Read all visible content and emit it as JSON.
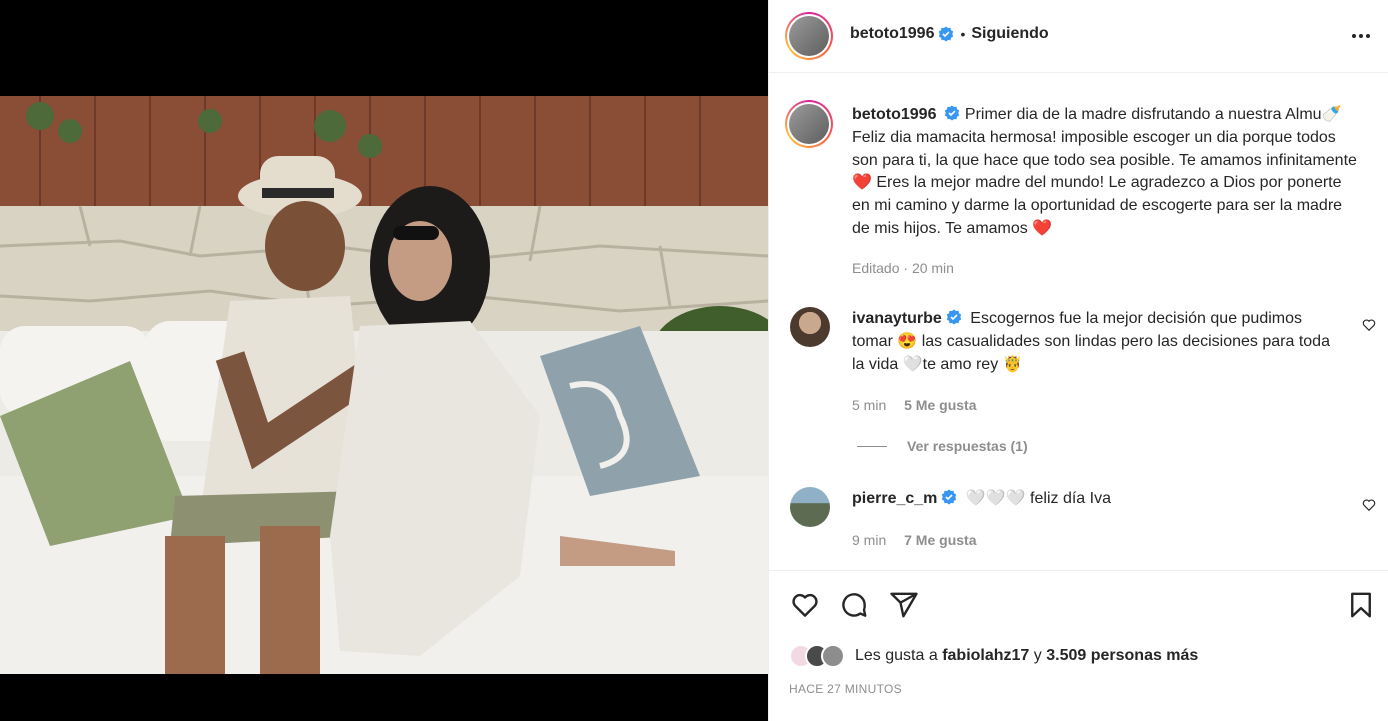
{
  "header": {
    "username": "betoto1996",
    "separator": "•",
    "follow_status": "Siguiendo"
  },
  "caption": {
    "username": "betoto1996",
    "text": "Primer dia de la madre disfrutando a nuestra Almu🍼 Feliz dia mamacita hermosa! imposible escoger un dia porque todos son para ti, la que hace que todo sea posible. Te amamos infinitamente❤️ Eres la mejor madre del mundo! Le agradezco a Dios por ponerte en mi camino y darme la oportunidad de escogerte para ser la madre de mis hijos. Te amamos ❤️",
    "edited": "Editado",
    "time": "20 min"
  },
  "comments": [
    {
      "username": "ivanayturbe",
      "text": "Escogernos fue la mejor decisión que pudimos tomar 😍 las casualidades son lindas pero las decisiones para toda la vida 🤍te amo rey 🤴",
      "time": "5 min",
      "likes": "5 Me gusta",
      "replies": "Ver respuestas (1)"
    },
    {
      "username": "pierre_c_m",
      "text": "🤍🤍🤍 feliz día Iva",
      "time": "9 min",
      "likes": "7 Me gusta"
    }
  ],
  "likes_line": {
    "prefix": "Les gusta a",
    "user": "fabiolahz17",
    "and": "y",
    "others": "3.509 personas más"
  },
  "posted_ago": "HACE 27 MINUTOS",
  "colors": {
    "verified": "#3897f0",
    "secondary_text": "#8e8e8e",
    "primary_text": "#262626",
    "like_heart": "#ed4956"
  },
  "icons": [
    "more-options-icon",
    "heart-icon",
    "comment-icon",
    "share-icon",
    "save-icon",
    "user-tag-icon",
    "verified-badge-icon"
  ]
}
